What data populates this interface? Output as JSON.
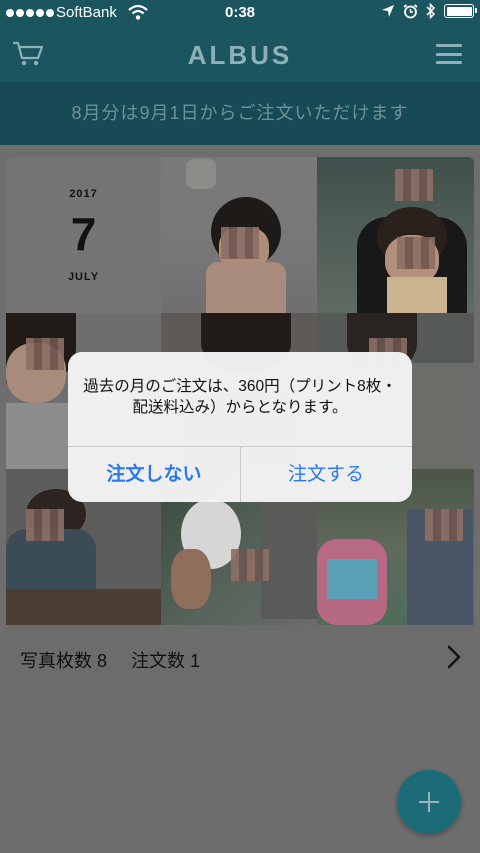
{
  "status_bar": {
    "carrier": "SoftBank",
    "time": "0:38"
  },
  "nav": {
    "logo": "ALBUS",
    "cart_icon": "cart-icon",
    "menu_icon": "hamburger-menu-icon"
  },
  "banner": {
    "text": "8月分は9月1日からご注文いただけます"
  },
  "month_card": {
    "year": "2017",
    "month": "7",
    "month_name": "JULY",
    "footer": {
      "photo_count_label": "写真枚数",
      "photo_count": "8",
      "order_count_label": "注文数",
      "order_count": "1"
    }
  },
  "alert": {
    "message": "過去の月のご注文は、360円（プリント8枚・配送料込み）からとなります。",
    "cancel_label": "注文しない",
    "confirm_label": "注文する"
  },
  "fab": {
    "icon": "plus-icon"
  },
  "colors": {
    "brand_teal": "#1b5560",
    "alert_button_blue": "#2a78f0",
    "fab": "#1c6b78"
  }
}
